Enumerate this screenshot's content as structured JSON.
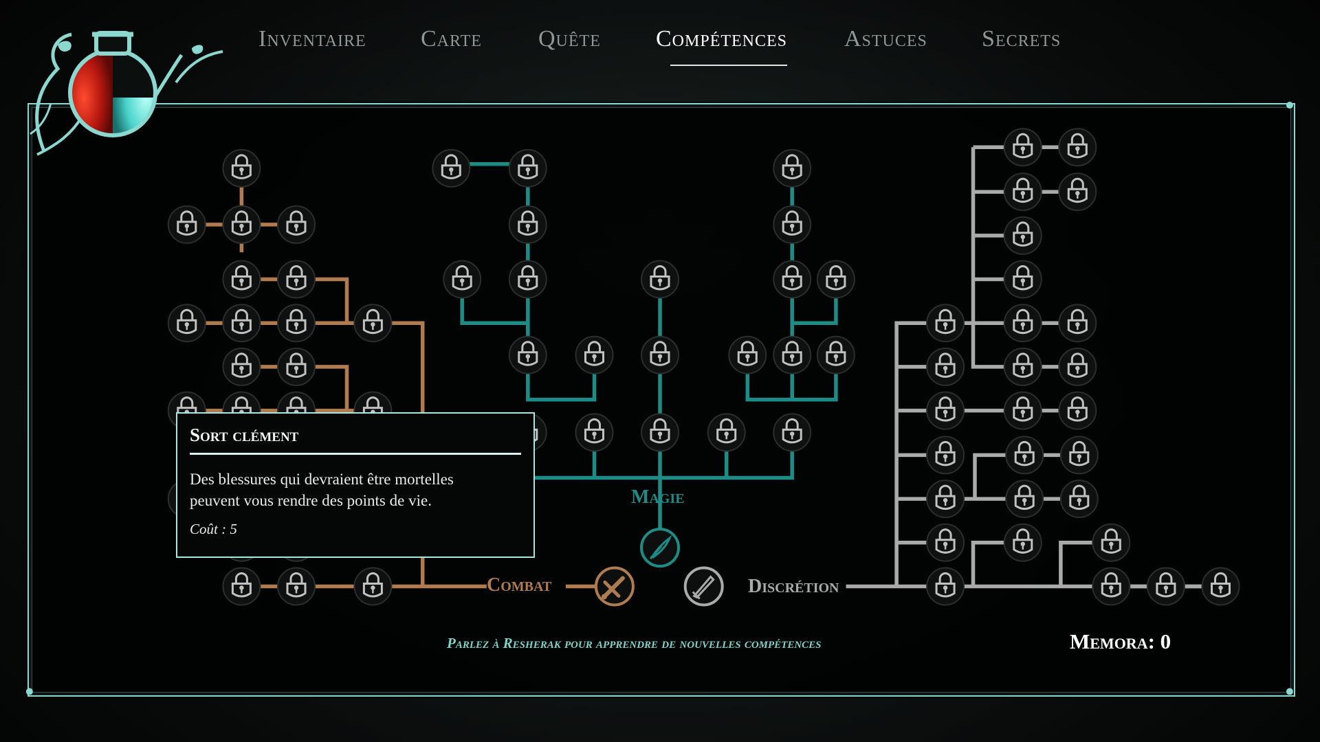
{
  "tabs": [
    {
      "label": "Inventaire",
      "active": false
    },
    {
      "label": "Carte",
      "active": false
    },
    {
      "label": "Quête",
      "active": false
    },
    {
      "label": "Compétences",
      "active": true
    },
    {
      "label": "Astuces",
      "active": false
    },
    {
      "label": "Secrets",
      "active": false
    }
  ],
  "categories": {
    "combat": {
      "label": "Combat",
      "color": "#b07c4f",
      "icon": "sword-icon"
    },
    "magie": {
      "label": "Magie",
      "color": "#1e8c86",
      "icon": "magic-feather-icon"
    },
    "discretion": {
      "label": "Discrétion",
      "color": "#a9aaa9",
      "icon": "dagger-icon"
    }
  },
  "tooltip": {
    "title": "Sort clément",
    "description_line1": "Des blessures qui devraient être mortelles",
    "description_line2": "peuvent vous rendre des points de vie.",
    "cost": "Coût : 5"
  },
  "hint": "Parlez à Resherak pour apprendre de nouvelles compétences",
  "memora": "Memora: 0",
  "colors": {
    "frame": "#8ad8d0",
    "locked_node": "#bfc2c1",
    "health_red": "#c0261c",
    "mana_cyan": "#4fd6d0"
  },
  "icons": {
    "locked_node": "padlock-icon",
    "emblem": "potion-flask-icon"
  }
}
